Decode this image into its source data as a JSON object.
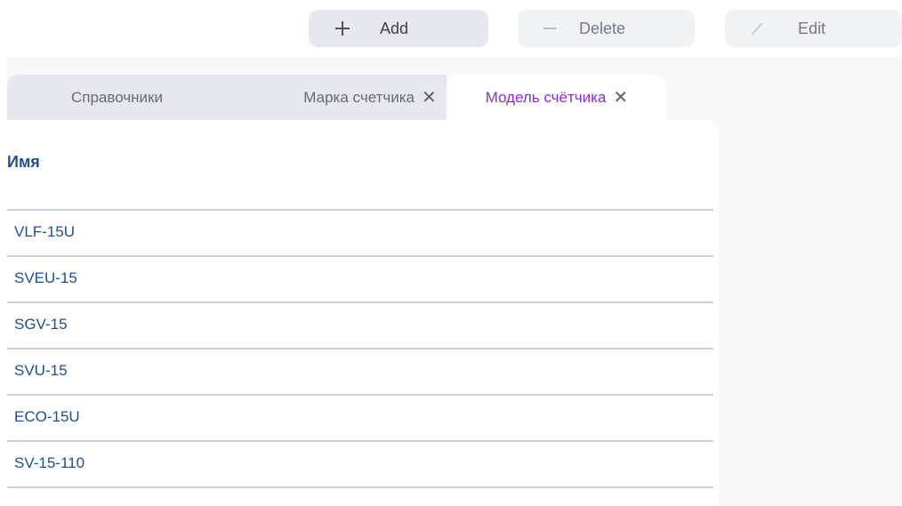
{
  "toolbar": {
    "add_label": "Add",
    "delete_label": "Delete",
    "edit_label": "Edit"
  },
  "tabs": [
    {
      "label": "Справочники"
    },
    {
      "label": "Марка счетчика",
      "close": "✕"
    },
    {
      "label": "Модель счётчика",
      "close": "✕",
      "active": true
    }
  ],
  "table": {
    "header": "Имя",
    "rows": [
      "VLF-15U",
      "SVEU-15",
      "SGV-15",
      "SVU-15",
      "ECO-15U",
      "SV-15-110"
    ]
  },
  "colors": {
    "accent": "#8a2be2",
    "text_link": "#1f4e8c"
  }
}
